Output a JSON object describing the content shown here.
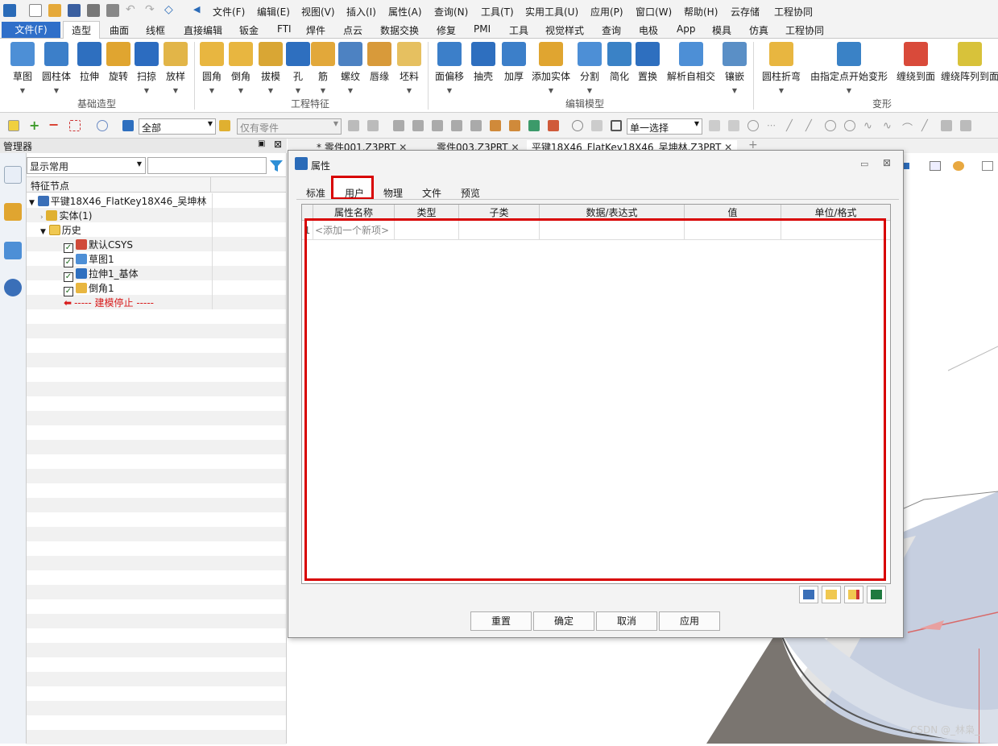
{
  "menu": [
    "文件(F)",
    "编辑(E)",
    "视图(V)",
    "插入(I)",
    "属性(A)",
    "查询(N)",
    "工具(T)",
    "实用工具(U)",
    "应用(P)",
    "窗口(W)",
    "帮助(H)",
    "云存储",
    "工程协同"
  ],
  "ribbon_tabs": [
    "文件(F)",
    "造型",
    "曲面",
    "线框",
    "直接编辑",
    "钣金",
    "FTI",
    "焊件",
    "点云",
    "数据交换",
    "修复",
    "PMI",
    "工具",
    "视觉样式",
    "查询",
    "电极",
    "App",
    "模具",
    "仿真",
    "工程协同"
  ],
  "active_ribbon_tab": "造型",
  "ribbon_groups": {
    "basic": {
      "label": "基础造型",
      "buttons": [
        "草图",
        "圆柱体",
        "拉伸",
        "旋转",
        "扫掠",
        "放样"
      ]
    },
    "eng": {
      "label": "工程特征",
      "buttons": [
        "圆角",
        "倒角",
        "拔模",
        "孔",
        "筋",
        "螺纹",
        "唇缘",
        "坯料"
      ]
    },
    "edit": {
      "label": "编辑模型",
      "buttons": [
        "面偏移",
        "抽壳",
        "加厚",
        "添加实体",
        "分割",
        "简化",
        "置换",
        "解析自相交",
        "镶嵌"
      ]
    },
    "deform": {
      "label": "变形",
      "buttons": [
        "圆柱折弯",
        "由指定点开始变形",
        "缠绕到面",
        "缠绕阵列到面"
      ]
    }
  },
  "selection": {
    "filter_value": "全部",
    "scope_value": "仅有零件",
    "mode_value": "单一选择"
  },
  "manager": {
    "title": "管理器",
    "filter_value": "显示常用",
    "tree_header": "特征节点",
    "root": "平键18X46_FlatKey18X46_吴坤林",
    "items": [
      "实体(1)",
      "历史",
      "默认CSYS",
      "草图1",
      "拉伸1_基体",
      "倒角1"
    ],
    "stop": "----- 建模停止 -----"
  },
  "doc_tabs": [
    "* 零件001.Z3PRT",
    "零件003.Z3PRT",
    "平键18X46_FlatKey18X46_吴坤林.Z3PRT"
  ],
  "dialog": {
    "title": "属性",
    "tabs": [
      "标准",
      "用户",
      "物理",
      "文件",
      "预览"
    ],
    "active_tab": "用户",
    "columns": [
      "属性名称",
      "类型",
      "子类",
      "数据/表达式",
      "值",
      "单位/格式"
    ],
    "row_num": "1",
    "add_placeholder": "<添加一个新项>",
    "buttons": [
      "重置",
      "确定",
      "取消",
      "应用"
    ]
  },
  "watermark": "CSDN @_林枭_",
  "colors": {
    "accent": "#2f6fc9",
    "highlight": "#d80000"
  }
}
